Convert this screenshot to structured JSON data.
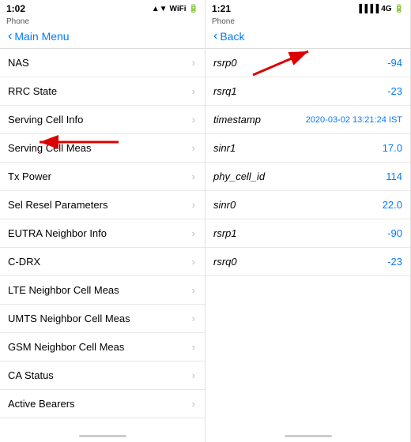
{
  "leftPanel": {
    "statusBar": {
      "time": "1:02",
      "carrier": "Phone",
      "icons": "▲▼ ☁ 🔋"
    },
    "navBack": "Main Menu",
    "menuItems": [
      {
        "label": "NAS",
        "hasChevron": true
      },
      {
        "label": "RRC State",
        "hasChevron": true
      },
      {
        "label": "Serving Cell Info",
        "hasChevron": true
      },
      {
        "label": "Serving Cell Meas",
        "hasChevron": true
      },
      {
        "label": "Tx Power",
        "hasChevron": true
      },
      {
        "label": "Sel Resel Parameters",
        "hasChevron": true
      },
      {
        "label": "EUTRA Neighbor Info",
        "hasChevron": true
      },
      {
        "label": "C-DRX",
        "hasChevron": true
      },
      {
        "label": "LTE Neighbor Cell Meas",
        "hasChevron": true
      },
      {
        "label": "UMTS Neighbor Cell Meas",
        "hasChevron": true
      },
      {
        "label": "GSM Neighbor Cell Meas",
        "hasChevron": true
      },
      {
        "label": "CA Status",
        "hasChevron": true
      },
      {
        "label": "Active Bearers",
        "hasChevron": true
      }
    ]
  },
  "rightPanel": {
    "statusBar": {
      "time": "1:21",
      "carrier": "Phone",
      "icons": "4G 🔋"
    },
    "navBack": "Back",
    "detailItems": [
      {
        "key": "rsrp0",
        "value": "-94"
      },
      {
        "key": "rsrq1",
        "value": "-23"
      },
      {
        "key": "timestamp",
        "value": "2020-03-02 13:21:24 IST",
        "isTimestamp": true
      },
      {
        "key": "sinr1",
        "value": "17.0"
      },
      {
        "key": "phy_cell_id",
        "value": "114"
      },
      {
        "key": "sinr0",
        "value": "22.0"
      },
      {
        "key": "rsrp1",
        "value": "-90"
      },
      {
        "key": "rsrq0",
        "value": "-23"
      }
    ]
  }
}
